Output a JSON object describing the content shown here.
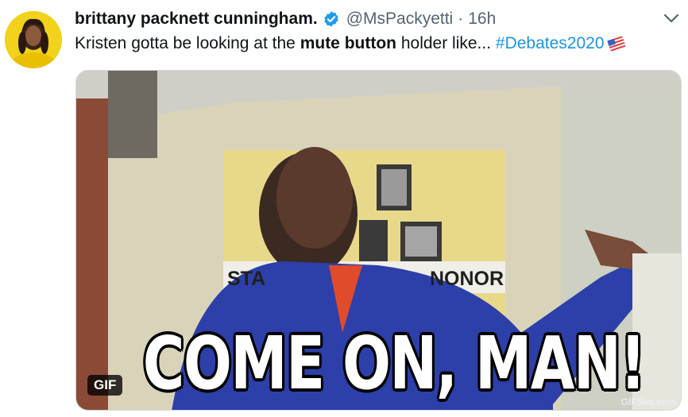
{
  "tweet": {
    "display_name": "brittany packnett cunningham.",
    "handle": "@MsPackyetti",
    "separator": "·",
    "time": "16h",
    "text_part1": "Kristen gotta be looking at the ",
    "text_bold": "mute button",
    "text_part2": " holder like... ",
    "hashtag": "#Debates2020"
  },
  "media": {
    "badge": "GIF",
    "caption": "COME ON, MAN!",
    "watermark": "GIFSec.com",
    "sign_left": "STA",
    "sign_right": "NONOR"
  },
  "icons": {
    "verified": "verified-badge-icon",
    "more": "chevron-down-icon",
    "flag": "us-flag-emoji-icon"
  },
  "colors": {
    "verified_blue": "#1d9bf0",
    "hashtag_blue": "#1b95e0",
    "secondary_text": "#536471"
  }
}
